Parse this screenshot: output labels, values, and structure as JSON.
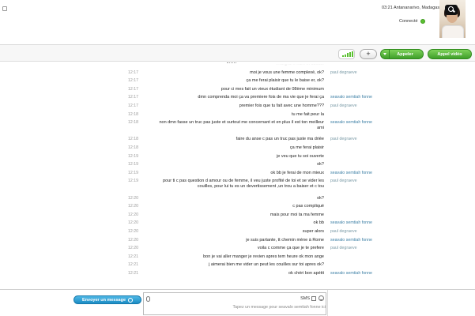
{
  "header": {
    "location": "03:21 Antananarivo, Madagascar",
    "status": "Connecté"
  },
  "toolbar": {
    "video_call": "Appel vidéo",
    "call": "Appeler",
    "plus": "+"
  },
  "messages": [
    {
      "text": "enargez enfant et ducate",
      "time": "",
      "sender": "",
      "sender_type": "a"
    },
    {
      "text": "moi je vous une femme complexé, ok?",
      "time": "12:17",
      "sender": "paul degraeve",
      "sender_type": "a"
    },
    {
      "text": "ça me ferai plaisir que tu le baise er, ok?",
      "time": "12:17",
      "sender": "",
      "sender_type": "a"
    },
    {
      "text": "pour ci mes fait un vieux étudiant de 08ème minimum",
      "time": "12:17",
      "sender": "",
      "sender_type": "a"
    },
    {
      "text": "dmn comprenda moi ça va premiere fois de ma vie que je ferai ça",
      "time": "12:17",
      "sender": "seavalo semtiah fonne",
      "sender_type": "b"
    },
    {
      "text": "premier fois que tu fait avec une homme???",
      "time": "12:17",
      "sender": "paul degraeve",
      "sender_type": "a"
    },
    {
      "text": "tu me fait peur la",
      "time": "12:18",
      "sender": "",
      "sender_type": "a"
    },
    {
      "text": "non dmn fasse un truc pas juste et surtout me concernant et en plus il est ton meilleur ami",
      "time": "12:18",
      "sender": "seavalo semtiah fonne",
      "sender_type": "b"
    },
    {
      "text": "faire du anse c pas un truc pas juste ma drièe",
      "time": "12:18",
      "sender": "paul degraeve",
      "sender_type": "a"
    },
    {
      "text": "ça me ferai plaisir",
      "time": "12:18",
      "sender": "",
      "sender_type": "a"
    },
    {
      "text": "je veu que tu soi ouverte",
      "time": "12:19",
      "sender": "",
      "sender_type": "a"
    },
    {
      "text": "ok?",
      "time": "12:19",
      "sender": "",
      "sender_type": "a"
    },
    {
      "text": "ok bb je ferai de mon mieux",
      "time": "12:19",
      "sender": "seavalo semtiah fonne",
      "sender_type": "b"
    },
    {
      "text": "pour ti c pas question d amour ou de femme, il veu juste profité de toi et se vider les couilles, pour lui tu es un devertissement ,un trou a baiser et c tou",
      "time": "12:19",
      "sender": "paul degraeve",
      "sender_type": "a"
    },
    {
      "text": "ok?",
      "time": "12:20",
      "sender": "",
      "sender_type": "a"
    },
    {
      "text": "c pas compliqué",
      "time": "12:20",
      "sender": "",
      "sender_type": "a"
    },
    {
      "text": "mais pour moi ta ma femme",
      "time": "12:20",
      "sender": "",
      "sender_type": "a"
    },
    {
      "text": "ok bb",
      "time": "12:20",
      "sender": "seavalo semtiah fonne",
      "sender_type": "b"
    },
    {
      "text": "super alors",
      "time": "12:20",
      "sender": "paul degraeve",
      "sender_type": "a"
    },
    {
      "text": "je suis partante, tt chemin mène à Rome",
      "time": "12:20",
      "sender": "seavalo semtiah fonne",
      "sender_type": "b"
    },
    {
      "text": "voila c comme ça que je te prefere",
      "time": "12:20",
      "sender": "paul degraeve",
      "sender_type": "a"
    },
    {
      "text": "bon je vai aller manger je revien apres tem heure ok mon ange",
      "time": "12:21",
      "sender": "",
      "sender_type": "a"
    },
    {
      "text": "j aimerai bien me vider un peut les couilles sur toi apres ok?",
      "time": "12:21",
      "sender": "",
      "sender_type": "a"
    },
    {
      "text": "ok chéri bon apétit",
      "time": "12:21",
      "sender": "seavalo semtiah fonne",
      "sender_type": "b"
    }
  ],
  "composer": {
    "placeholder": "Tapez un message pour seavalo semtiah fonne ici",
    "sms_label": "SMS",
    "send_label": "Envoyer un message"
  },
  "colors": {
    "green_button": "#4fb330",
    "blue_button": "#1b8cc4",
    "sender_light": "#7a9aa6",
    "sender_dark": "#3c7fa5"
  }
}
